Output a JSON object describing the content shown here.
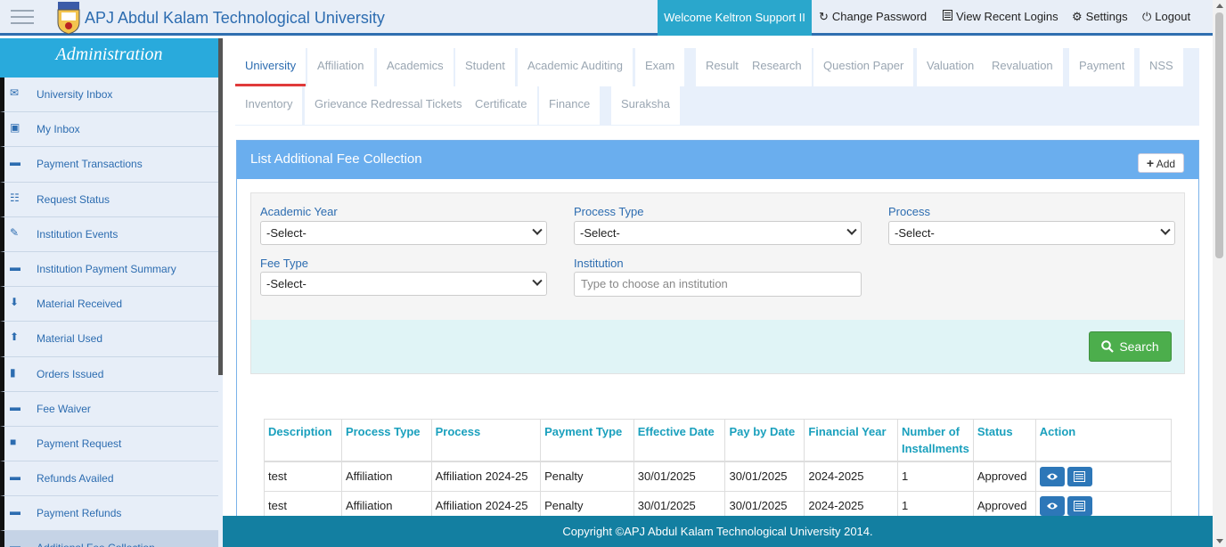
{
  "header": {
    "brand": "APJ Abdul Kalam Technological University",
    "welcome": "Welcome Keltron Support II",
    "change_password": "Change Password",
    "view_recent_logins": "View Recent Logins",
    "settings": "Settings",
    "logout": "Logout"
  },
  "sidebar": {
    "title": "Administration",
    "items": [
      {
        "label": "University Inbox",
        "icon": "envelope-icon"
      },
      {
        "label": "My Inbox",
        "icon": "inbox-icon"
      },
      {
        "label": "Payment Transactions",
        "icon": "credit-card-icon"
      },
      {
        "label": "Request Status",
        "icon": "cc-icon"
      },
      {
        "label": "Institution Events",
        "icon": "edit-check-icon"
      },
      {
        "label": "Institution Payment Summary",
        "icon": "credit-card-icon"
      },
      {
        "label": "Material Received",
        "icon": "arrow-down-circle-icon"
      },
      {
        "label": "Material Used",
        "icon": "arrow-up-circle-icon"
      },
      {
        "label": "Orders Issued",
        "icon": "file-icon"
      },
      {
        "label": "Fee Waiver",
        "icon": "credit-card-icon"
      },
      {
        "label": "Payment Request",
        "icon": "comment-icon"
      },
      {
        "label": "Refunds Availed",
        "icon": "credit-card-icon"
      },
      {
        "label": "Payment Refunds",
        "icon": "credit-card-icon"
      },
      {
        "label": "Additional Fee Collection",
        "icon": "credit-card-icon"
      }
    ]
  },
  "tabs": [
    "University",
    "Affiliation",
    "Academics",
    "Student",
    "Academic Auditing",
    "Exam",
    "Result",
    "Research",
    "Question Paper",
    "Valuation",
    "Revaluation",
    "Payment",
    "NSS",
    "Inventory",
    "Grievance Redressal Tickets",
    "Certificate",
    "Finance",
    "Suraksha"
  ],
  "panel": {
    "title": "List Additional Fee Collection",
    "add_label": "Add"
  },
  "filters": {
    "academic_year_label": "Academic Year",
    "academic_year_value": "-Select-",
    "process_type_label": "Process Type",
    "process_type_value": "-Select-",
    "process_label": "Process",
    "process_value": "-Select-",
    "fee_type_label": "Fee Type",
    "fee_type_value": "-Select-",
    "institution_label": "Institution",
    "institution_placeholder": "Type to choose an institution",
    "search_label": "Search"
  },
  "table": {
    "headers": [
      "Description",
      "Process Type",
      "Process",
      "Payment Type",
      "Effective Date",
      "Pay by Date",
      "Financial Year",
      "Number of Installments",
      "Status",
      "Action"
    ],
    "rows": [
      [
        "test",
        "Affiliation",
        "Affiliation 2024-25",
        "Penalty",
        "30/01/2025",
        "30/01/2025",
        "2024-2025",
        "1",
        "Approved"
      ],
      [
        "test",
        "Affiliation",
        "Affiliation 2024-25",
        "Penalty",
        "30/01/2025",
        "30/01/2025",
        "2024-2025",
        "1",
        "Approved"
      ]
    ]
  },
  "footer": "Copyright ©APJ Abdul Kalam Technological University 2014."
}
